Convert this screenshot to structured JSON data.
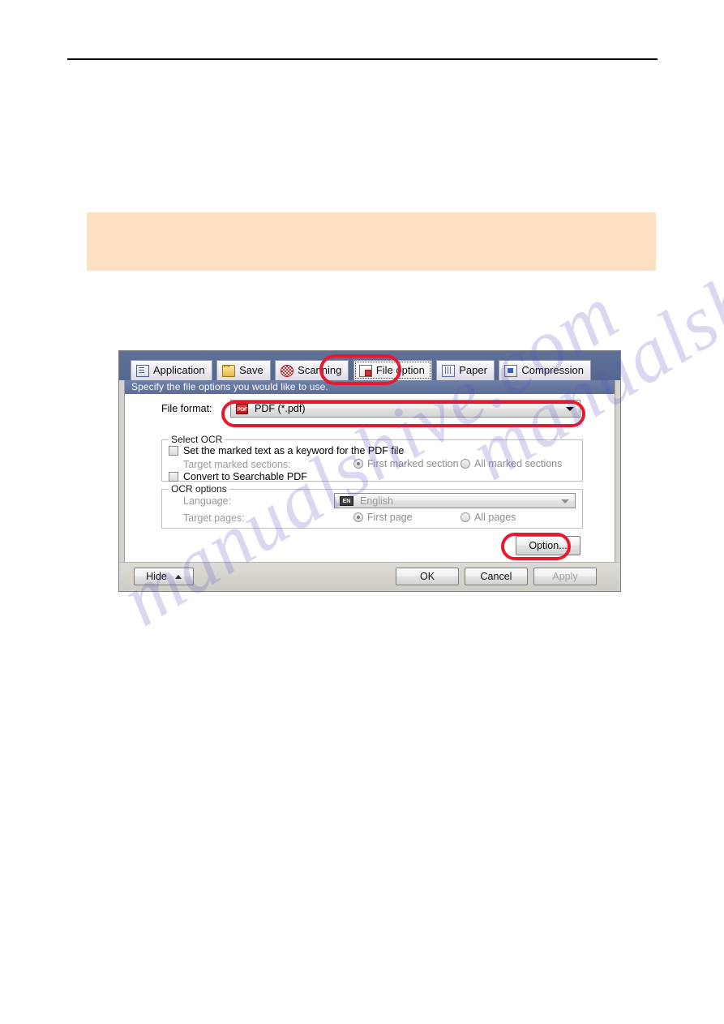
{
  "page": {
    "callout_note": ""
  },
  "dialog": {
    "tabs": [
      {
        "label": "Application",
        "icon": "application-icon",
        "selected": false
      },
      {
        "label": "Save",
        "icon": "folder-save-icon",
        "selected": false
      },
      {
        "label": "Scanning",
        "icon": "scanning-icon",
        "selected": false
      },
      {
        "label": "File option",
        "icon": "file-option-icon",
        "selected": true
      },
      {
        "label": "Paper",
        "icon": "paper-icon",
        "selected": false
      },
      {
        "label": "Compression",
        "icon": "compression-icon",
        "selected": false
      }
    ],
    "banner": "Specify the file options you would like to use.",
    "file_format": {
      "label": "File format:",
      "value": "PDF (*.pdf)",
      "badge": "PDF"
    },
    "select_ocr": {
      "title": "Select OCR",
      "keyword_checkbox": "Set the marked text as a keyword for the PDF file",
      "target_sections_label": "Target marked sections:",
      "radio_first": "First marked section",
      "radio_all": "All marked sections",
      "searchable_checkbox": "Convert to Searchable PDF"
    },
    "ocr_options": {
      "title": "OCR options",
      "language_label": "Language:",
      "language_value": "English",
      "language_badge": "EN",
      "target_pages_label": "Target pages:",
      "radio_first_page": "First page",
      "radio_all_pages": "All pages"
    },
    "buttons": {
      "option": "Option...",
      "hide": "Hide",
      "ok": "OK",
      "cancel": "Cancel",
      "apply": "Apply"
    }
  },
  "watermark": {
    "line_one": "manualshive.com",
    "line_two": "manualshive.com"
  },
  "colors": {
    "callout_bg": "#fde0c2",
    "tabstrip": "#5a6e99",
    "banner": "#6d80a8",
    "annotation_red": "#e8192c",
    "watermark": "#5b53c4"
  }
}
